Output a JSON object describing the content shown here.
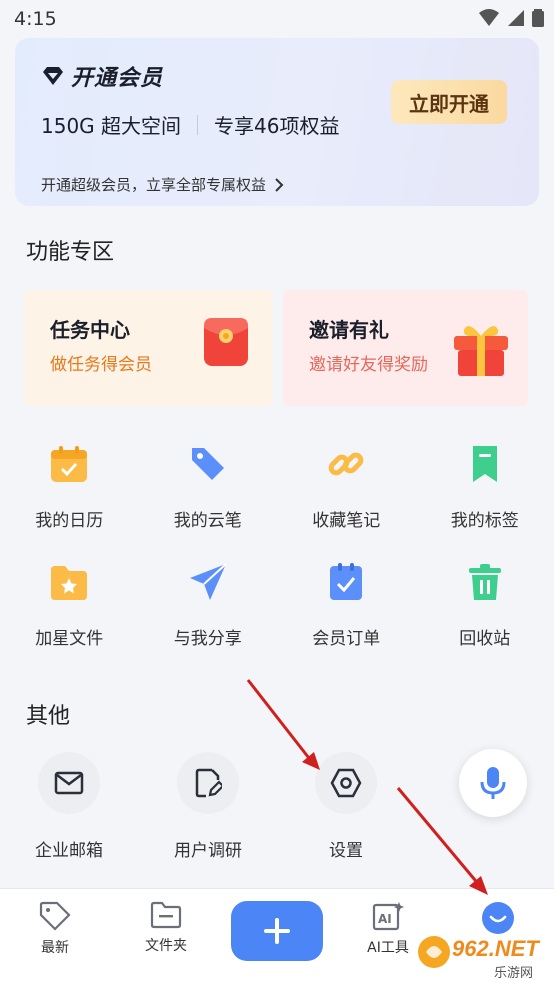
{
  "status": {
    "time": "4:15"
  },
  "vip": {
    "title": "开通会员",
    "space": "150G 超大空间",
    "benefit": "专享46项权益",
    "open_button": "立即开通",
    "subtitle": "开通超级会员，立享全部专属权益"
  },
  "features": {
    "title": "功能专区",
    "promos": [
      {
        "title": "任务中心",
        "subtitle": "做任务得会员"
      },
      {
        "title": "邀请有礼",
        "subtitle": "邀请好友得奖励"
      }
    ],
    "row1": [
      {
        "label": "我的日历",
        "icon": "calendar-icon"
      },
      {
        "label": "我的云笔",
        "icon": "pen-icon"
      },
      {
        "label": "收藏笔记",
        "icon": "link-icon"
      },
      {
        "label": "我的标签",
        "icon": "bookmark-icon"
      }
    ],
    "row2": [
      {
        "label": "加星文件",
        "icon": "star-folder-icon"
      },
      {
        "label": "与我分享",
        "icon": "send-icon"
      },
      {
        "label": "会员订单",
        "icon": "order-icon"
      },
      {
        "label": "回收站",
        "icon": "trash-icon"
      }
    ]
  },
  "other": {
    "title": "其他",
    "items": [
      {
        "label": "企业邮箱",
        "icon": "mail-icon"
      },
      {
        "label": "用户调研",
        "icon": "survey-icon"
      },
      {
        "label": "设置",
        "icon": "settings-icon"
      }
    ]
  },
  "nav": {
    "items": [
      {
        "label": "最新",
        "icon": "tag-icon"
      },
      {
        "label": "文件夹",
        "icon": "folder-icon"
      },
      {
        "label": "AI工具",
        "icon": "ai-icon"
      }
    ]
  },
  "colors": {
    "accent": "#4c85f6",
    "vip_button": "#fbd9a0",
    "task_orange": "#e6791d",
    "invite_red": "#e8675b"
  },
  "watermark": {
    "text": "962.NET",
    "sub": "乐游网"
  }
}
